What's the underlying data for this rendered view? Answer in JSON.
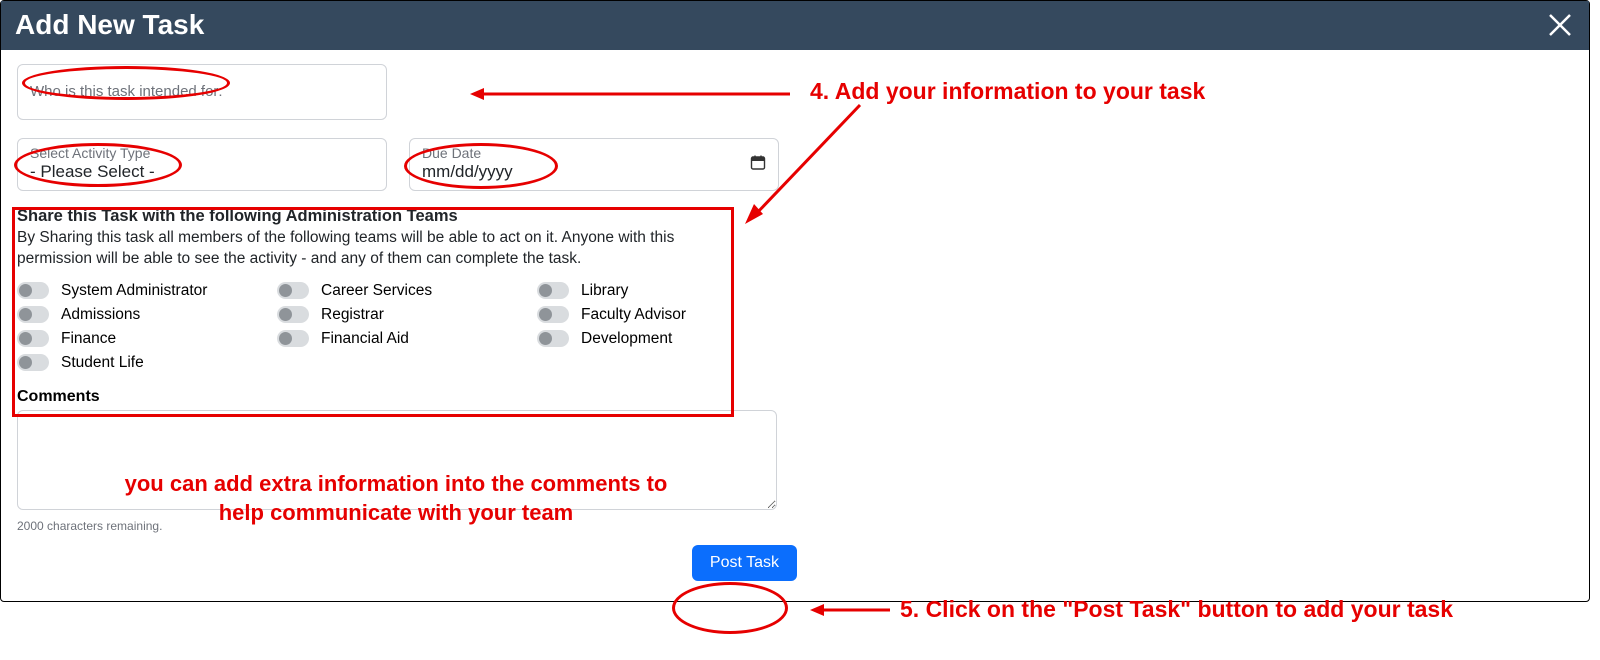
{
  "modal": {
    "title": "Add New Task",
    "intended_placeholder": "Who is this task intended for:",
    "activity_label": "Select Activity Type",
    "activity_value": "- Please Select -",
    "due_label": "Due Date",
    "due_value": "mm/dd/yyyy",
    "share_title": "Share this Task with the following Administration Teams",
    "share_desc": "By Sharing this task all members of the following teams will be able to act on it. Anyone with this permission will be able to see the activity - and any of them can complete the task.",
    "teams": {
      "c1r1": "System Administrator",
      "c1r2": "Admissions",
      "c1r3": "Finance",
      "c1r4": "Student Life",
      "c2r1": "Career Services",
      "c2r2": "Registrar",
      "c2r3": "Financial Aid",
      "c3r1": "Library",
      "c3r2": "Faculty Advisor",
      "c3r3": "Development"
    },
    "comments_label": "Comments",
    "chars_remaining": "2000 characters remaining.",
    "post_button": "Post Task"
  },
  "annotations": {
    "step4": "4. Add your information to your task",
    "comments_hint_line1": "you can add extra information into the comments to",
    "comments_hint_line2": "help communicate with your team",
    "step5": "5. Click on the \"Post Task\" button to add your task"
  }
}
